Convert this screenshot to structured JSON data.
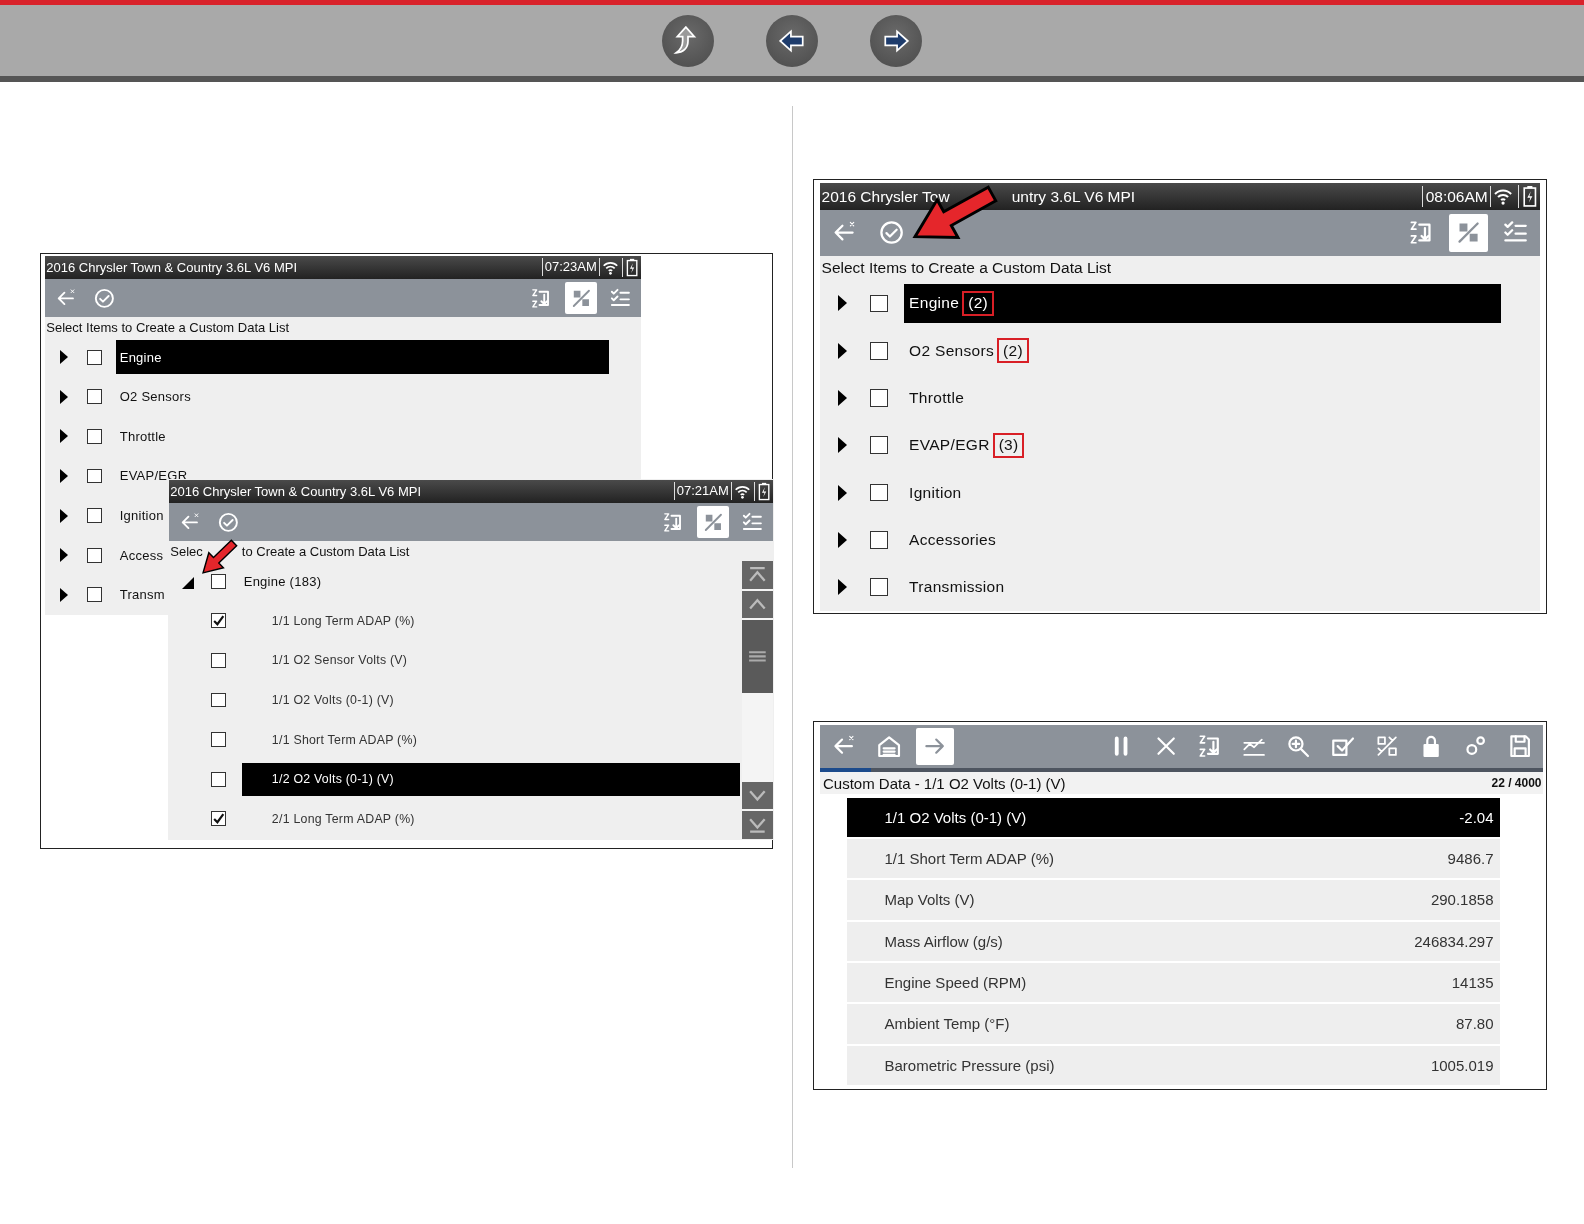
{
  "nav_buttons": [
    {
      "kind": "up"
    },
    {
      "kind": "back"
    },
    {
      "kind": "forward"
    }
  ],
  "figure_left": {
    "back_screen": {
      "title": [
        "2016 Chrysler Town & Country 3.6L V6 MPI"
      ],
      "time": "07:23AM",
      "tools_left": [
        {
          "kind": "back",
          "selected": false
        },
        {
          "kind": "confirm",
          "selected": false
        }
      ],
      "tools_right": [
        {
          "kind": "sort",
          "selected": false
        },
        {
          "kind": "collapse",
          "selected": true
        },
        {
          "kind": "select-all",
          "selected": false
        }
      ],
      "instruction": [
        "Select Items to Create a Custom Data List"
      ],
      "items": [
        {
          "label": "Engine",
          "checked": false,
          "expanded": false,
          "selected": true
        },
        {
          "label": "O2 Sensors",
          "checked": false,
          "expanded": false,
          "selected": false
        },
        {
          "label": "Throttle",
          "checked": false,
          "expanded": false,
          "selected": false
        },
        {
          "label": "EVAP/EGR",
          "checked": false,
          "expanded": false,
          "selected": false
        },
        {
          "label": "Ignition",
          "checked": false,
          "expanded": false,
          "selected": false
        },
        {
          "label": "Access",
          "checked": false,
          "expanded": false,
          "selected": false
        },
        {
          "label": "Transm",
          "checked": false,
          "expanded": false,
          "selected": false
        }
      ]
    },
    "front_screen": {
      "title": [
        "2016 Chrysler Town & Country 3.6L V6 MPI"
      ],
      "time": "07:21AM",
      "tools_left": [
        {
          "kind": "back",
          "selected": false
        },
        {
          "kind": "confirm",
          "selected": false
        }
      ],
      "tools_right": [
        {
          "kind": "sort",
          "selected": false
        },
        {
          "kind": "collapse",
          "selected": true
        },
        {
          "kind": "select-all",
          "selected": false
        }
      ],
      "instruction": [
        "Selec",
        "to Create a Custom Data List"
      ],
      "scrollbar": true,
      "items": [
        {
          "label": "Engine (183)",
          "checked": false,
          "expanded": true,
          "selected": false,
          "children": [
            {
              "label": "1/1 Long Term ADAP (%)",
              "checked": true,
              "selected": false
            },
            {
              "label": "1/1 O2 Sensor Volts (V)",
              "checked": false,
              "selected": false
            },
            {
              "label": "1/1 O2 Volts (0-1) (V)",
              "checked": false,
              "selected": false
            },
            {
              "label": "1/1 Short Term ADAP (%)",
              "checked": false,
              "selected": false
            },
            {
              "label": "1/2 O2 Volts (0-1) (V)",
              "checked": false,
              "selected": true
            },
            {
              "label": "2/1 Long Term ADAP (%)",
              "checked": true,
              "selected": false
            }
          ]
        }
      ]
    }
  },
  "figure_right_top": {
    "screen": {
      "title": [
        "2016 Chrysler Tow",
        "untry 3.6L V6 MPI"
      ],
      "time": "08:06AM",
      "tools_left": [
        {
          "kind": "back",
          "selected": false
        },
        {
          "kind": "confirm",
          "selected": false
        }
      ],
      "tools_right": [
        {
          "kind": "sort",
          "selected": false
        },
        {
          "kind": "collapse",
          "selected": true
        },
        {
          "kind": "select-all",
          "selected": false
        }
      ],
      "instruction": [
        "Select Items to Create a Custom Data List"
      ],
      "items": [
        {
          "label": "Engine",
          "count": "(2)",
          "count_highlighted": true,
          "checked": false,
          "expanded": false,
          "selected": true
        },
        {
          "label": "O2 Sensors",
          "count": "(2)",
          "count_highlighted": true,
          "checked": false,
          "expanded": false,
          "selected": false
        },
        {
          "label": "Throttle",
          "checked": false,
          "expanded": false,
          "selected": false
        },
        {
          "label": "EVAP/EGR",
          "count": "(3)",
          "count_highlighted": true,
          "checked": false,
          "expanded": false,
          "selected": false
        },
        {
          "label": "Ignition",
          "checked": false,
          "expanded": false,
          "selected": false
        },
        {
          "label": "Accessories",
          "checked": false,
          "expanded": false,
          "selected": false
        },
        {
          "label": "Transmission",
          "checked": false,
          "expanded": false,
          "selected": false
        }
      ]
    }
  },
  "figure_right_bottom": {
    "screen": {
      "tools_left": [
        {
          "kind": "back",
          "selected": false
        },
        {
          "kind": "home",
          "selected": false
        },
        {
          "kind": "forward",
          "selected": true
        }
      ],
      "tools_right": [
        {
          "kind": "pause",
          "selected": false
        },
        {
          "kind": "close",
          "selected": false
        },
        {
          "kind": "sort",
          "selected": false
        },
        {
          "kind": "graph",
          "selected": false
        },
        {
          "kind": "zoom",
          "selected": false
        },
        {
          "kind": "check",
          "selected": false
        },
        {
          "kind": "split",
          "selected": false
        },
        {
          "kind": "lock",
          "selected": false
        },
        {
          "kind": "settings",
          "selected": false
        },
        {
          "kind": "save",
          "selected": false
        }
      ],
      "progress": {
        "level": 0.07
      },
      "title": "Custom Data - 1/1 O2 Volts (0-1) (V)",
      "counter": "22 / 4000",
      "rows": [
        {
          "name": "1/1 O2 Volts (0-1) (V)",
          "value": "-2.04",
          "selected": true
        },
        {
          "name": "1/1 Short Term ADAP (%)",
          "value": "9486.7",
          "selected": false
        },
        {
          "name": "Map Volts (V)",
          "value": "290.1858",
          "selected": false
        },
        {
          "name": "Mass Airflow (g/s)",
          "value": "246834.297",
          "selected": false
        },
        {
          "name": "Engine Speed (RPM)",
          "value": "14135",
          "selected": false
        },
        {
          "name": "Ambient Temp (°F)",
          "value": "87.80",
          "selected": false
        },
        {
          "name": "Barometric Pressure (psi)",
          "value": "1005.019",
          "selected": false
        }
      ]
    }
  }
}
